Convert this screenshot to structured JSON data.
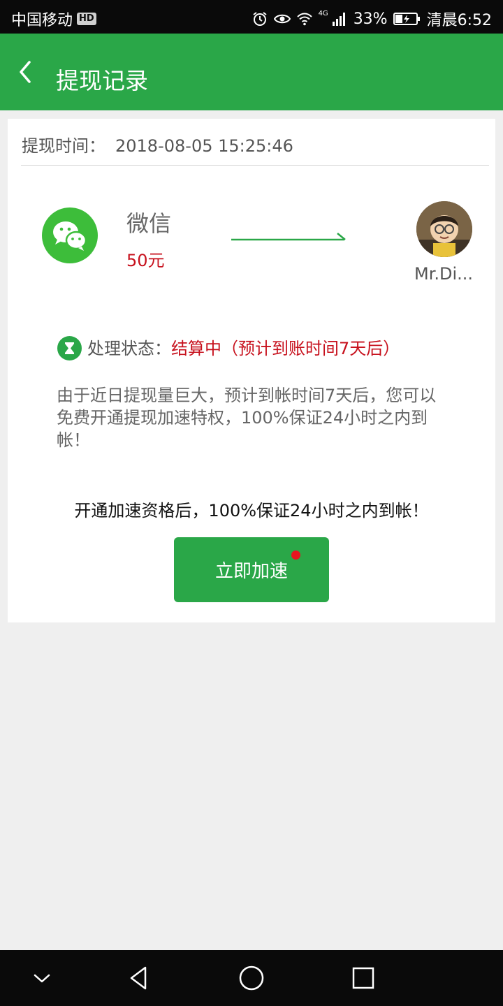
{
  "status_bar": {
    "carrier": "中国移动",
    "hd_badge": "HD",
    "network": "4G",
    "battery": "33%",
    "time": "清晨6:52"
  },
  "header": {
    "title": "提现记录",
    "back_icon": "chevron-left-icon"
  },
  "record": {
    "time_label": "提现时间：",
    "time_value": "2018-08-05 15:25:46",
    "channel_name": "微信",
    "amount": "50元",
    "payee_name": "Mr.Di...",
    "status_label": "处理状态：",
    "status_value": "结算中（预计到账时间7天后）",
    "notice": "由于近日提现量巨大，预计到帐时间7天后，您可以免费开通提现加速特权，100%保证24小时之内到帐！",
    "promo": "开通加速资格后，100%保证24小时之内到帐！",
    "button_label": "立即加速"
  },
  "colors": {
    "brand_green": "#2aa748",
    "wechat_green": "#3dbd3a",
    "alert_red": "#c7111d",
    "background": "#efefef"
  },
  "navbar": {
    "icons": [
      "chevron-down-icon",
      "back-triangle-icon",
      "home-circle-icon",
      "recents-square-icon"
    ]
  }
}
